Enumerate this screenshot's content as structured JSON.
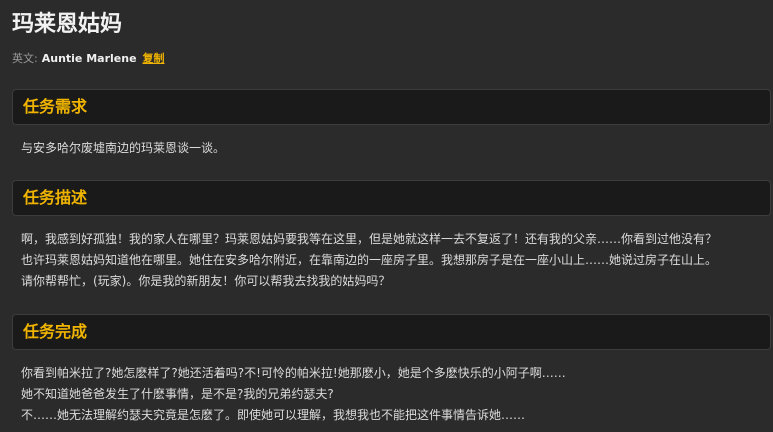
{
  "page": {
    "title": "玛莱恩姑妈",
    "english_label": "英文:",
    "english_name": "Auntie Marlene",
    "copy_label": "复制"
  },
  "sections": [
    {
      "header": "任务需求",
      "lines": [
        "与安多哈尔废墟南边的玛莱恩谈一谈。"
      ]
    },
    {
      "header": "任务描述",
      "lines": [
        "啊，我感到好孤独！我的家人在哪里？玛莱恩姑妈要我等在这里，但是她就这样一去不复返了！还有我的父亲……你看到过他没有？",
        "也许玛莱恩姑妈知道他在哪里。她住在安多哈尔附近，在靠南边的一座房子里。我想那房子是在一座小山上……她说过房子在山上。",
        "请你帮帮忙，(玩家)。你是我的新朋友！你可以帮我去找我的姑妈吗？"
      ]
    },
    {
      "header": "任务完成",
      "lines": [
        "你看到帕米拉了?她怎麽样了?她还活着吗?不!可怜的帕米拉!她那麽小，她是个多麽快乐的小阿子啊……",
        "她不知道她爸爸发生了什麽事情，是不是?我的兄弟约瑟夫?",
        "不……她无法理解约瑟夫究竟是怎麽了。即使她可以理解，我想我也不能把这件事情告诉她……"
      ]
    }
  ]
}
